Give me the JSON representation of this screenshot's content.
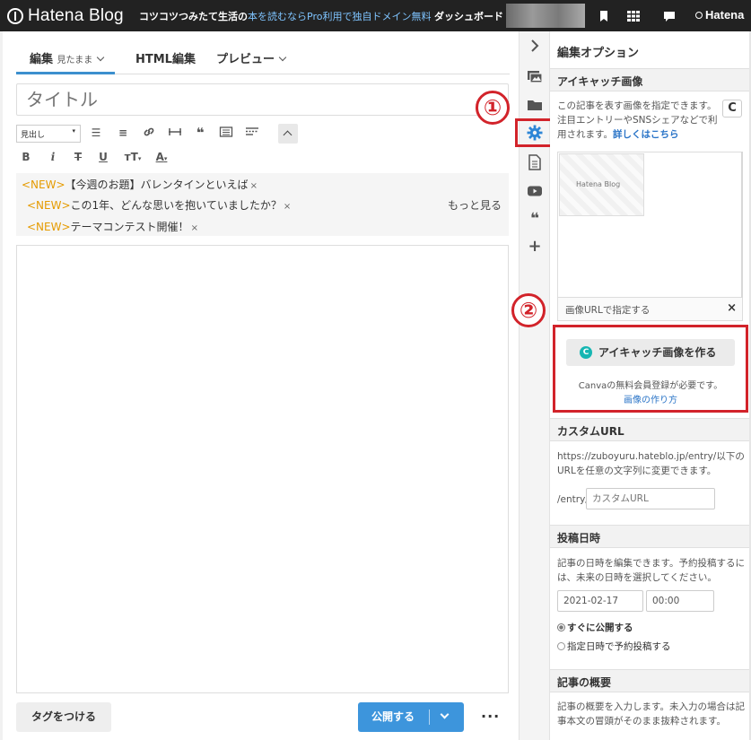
{
  "topbar": {
    "logo": "Hatena Blog",
    "blog_title": "コツコツつみたて生活の",
    "promo": "本を読むならPro利用で独自ドメイン無料",
    "dashboard": "ダッシュボード",
    "hatena_right": "Hatena"
  },
  "editor": {
    "tabs": [
      {
        "label": "編集",
        "sub": "見たまま"
      },
      {
        "label": "HTML編集",
        "sub": ""
      },
      {
        "label": "プレビュー",
        "sub": ""
      }
    ],
    "title_placeholder": "タイトル",
    "heading_select": "見出し",
    "news": [
      {
        "tag": "<NEW>",
        "text": "【今週のお題】バレンタインといえば"
      },
      {
        "tag": "<NEW>",
        "text": "この1年、どんな思いを抱いていましたか？"
      },
      {
        "tag": "<NEW>",
        "text": "テーマコンテスト開催！"
      }
    ],
    "news_close": "×",
    "more_label": "もっと見る",
    "tag_button": "タグをつける",
    "publish_button": "公開する",
    "more_dots": "···"
  },
  "callouts": {
    "first": "①",
    "second": "②"
  },
  "panel": {
    "title": "編集オプション",
    "eyecatch": {
      "heading": "アイキャッチ画像",
      "desc": "この記事を表す画像を指定できます。注目エントリーやSNSシェアなどで利用されます。",
      "link": "詳しくはこちら",
      "refresh": "C",
      "thumb_label": "Hatena Blog",
      "url_label": "画像URLで指定する",
      "url_close": "×"
    },
    "canva": {
      "button": "アイキャッチ画像を作る",
      "logo_letter": "C",
      "note": "Canvaの無料会員登録が必要です。",
      "link": "画像の作り方"
    },
    "custom_url": {
      "heading": "カスタムURL",
      "desc": "https://zuboyuru.hateblo.jp/entry/以下のURLを任意の文字列に変更できます。",
      "prefix": "/entry/",
      "placeholder": "カスタムURL"
    },
    "post_date": {
      "heading": "投稿日時",
      "desc": "記事の日時を編集できます。予約投稿するには、未来の日時を選択してください。",
      "date": "2021-02-17",
      "time": "00:00",
      "option_now": "すぐに公開する",
      "option_schedule": "指定日時で予約投稿する"
    },
    "summary": {
      "heading": "記事の概要",
      "desc": "記事の概要を入力します。未入力の場合は記事本文の冒頭がそのまま抜粋されます。"
    }
  },
  "colors": {
    "accent": "#3d95dc",
    "highlight": "#d2232a",
    "new_tag": "#e59b00"
  }
}
